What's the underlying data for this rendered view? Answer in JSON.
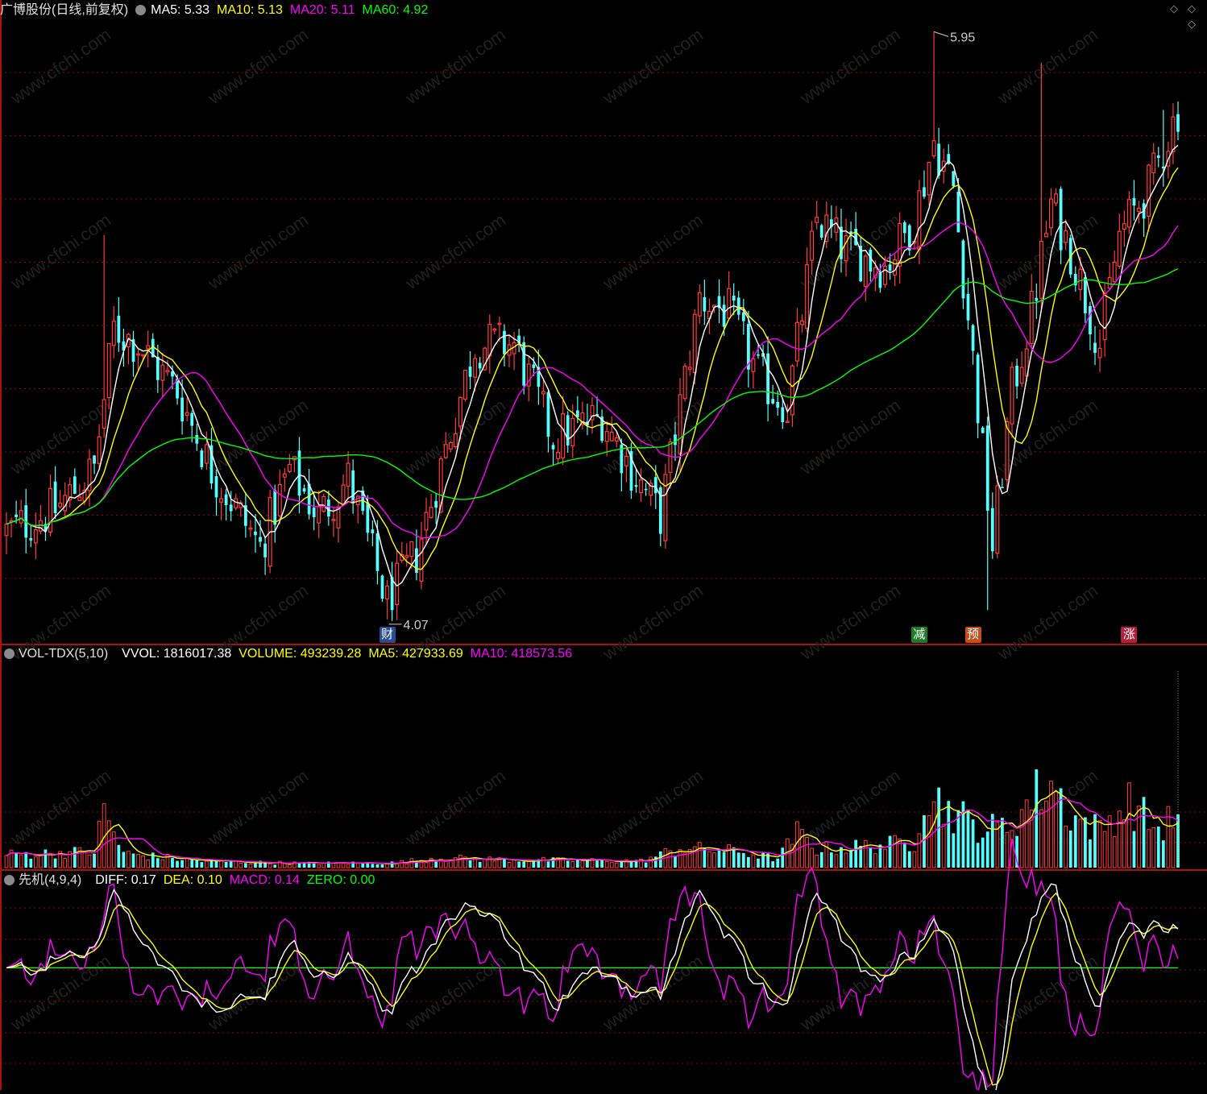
{
  "price_panel": {
    "title": "广博股份(日线,前复权)",
    "ma_items": [
      {
        "label": "MA5: 5.33",
        "color": "#ffffff"
      },
      {
        "label": "MA10: 5.13",
        "color": "#ffff00"
      },
      {
        "label": "MA20: 5.11",
        "color": "#ff00ff"
      },
      {
        "label": "MA60: 4.92",
        "color": "#00ff00"
      }
    ],
    "high_label": "5.95",
    "low_label": "4.07",
    "events": [
      {
        "label": "财",
        "day": 78,
        "bg": "#2a4d8f"
      },
      {
        "label": "减",
        "day": 187,
        "bg": "#1f7a2a"
      },
      {
        "label": "预",
        "day": 198,
        "bg": "#c0501c"
      },
      {
        "label": "涨",
        "day": 230,
        "bg": "#b0203a"
      }
    ]
  },
  "volume_panel": {
    "title": "VOL-TDX(5,10)",
    "items": [
      {
        "label": "VVOL: 1816017.38",
        "color": "#ffffff"
      },
      {
        "label": "VOLUME: 493239.28",
        "color": "#ffff00"
      },
      {
        "label": "MA5: 427933.69",
        "color": "#ffff00"
      },
      {
        "label": "MA10: 418573.56",
        "color": "#ff00ff"
      }
    ]
  },
  "macd_panel": {
    "title": "先机(4,9,4)",
    "items": [
      {
        "label": "DIFF: 0.17",
        "color": "#ffffff"
      },
      {
        "label": "DEA: 0.10",
        "color": "#ffff00"
      },
      {
        "label": "MACD: 0.14",
        "color": "#ff00ff"
      },
      {
        "label": "ZERO: 0.00",
        "color": "#00ff00"
      }
    ]
  },
  "corner_icons": [
    "diamond-icon",
    "diamond-icon",
    "diamond-icon"
  ],
  "watermark": "www.cfchi.com",
  "colors": {
    "up": "#ff3b3b",
    "down": "#54ffff",
    "grid": "#8a0a0a",
    "border": "#aa1111"
  },
  "chart_data": {
    "type": "candlestick",
    "days": 241,
    "price_range": [
      4.0,
      6.0
    ],
    "price_min": 4.07,
    "price_max": 5.95,
    "ma_periods": [
      5,
      10,
      20,
      60
    ],
    "price_path": [
      [
        0,
        4.35
      ],
      [
        10,
        4.42
      ],
      [
        18,
        4.55
      ],
      [
        22,
        5.0
      ],
      [
        27,
        4.95
      ],
      [
        35,
        4.8
      ],
      [
        42,
        4.55
      ],
      [
        46,
        4.45
      ],
      [
        52,
        4.3
      ],
      [
        58,
        4.55
      ],
      [
        64,
        4.4
      ],
      [
        70,
        4.52
      ],
      [
        78,
        4.12
      ],
      [
        84,
        4.28
      ],
      [
        96,
        4.95
      ],
      [
        104,
        4.95
      ],
      [
        112,
        4.65
      ],
      [
        122,
        4.72
      ],
      [
        128,
        4.55
      ],
      [
        134,
        4.4
      ],
      [
        142,
        5.1
      ],
      [
        148,
        5.05
      ],
      [
        154,
        4.85
      ],
      [
        160,
        4.75
      ],
      [
        166,
        5.35
      ],
      [
        172,
        5.25
      ],
      [
        180,
        5.2
      ],
      [
        186,
        5.35
      ],
      [
        190,
        5.6
      ],
      [
        194,
        5.45
      ],
      [
        198,
        4.9
      ],
      [
        202,
        4.3
      ],
      [
        206,
        4.8
      ],
      [
        210,
        5.05
      ],
      [
        214,
        5.4
      ],
      [
        218,
        5.25
      ],
      [
        224,
        4.95
      ],
      [
        228,
        5.3
      ],
      [
        234,
        5.45
      ],
      [
        240,
        5.7
      ]
    ],
    "spikes": [
      {
        "day": 190,
        "high": 5.95
      },
      {
        "day": 20,
        "high": 5.3
      },
      {
        "day": 212,
        "high": 5.85
      },
      {
        "day": 237,
        "high": 5.7
      }
    ],
    "dips": [
      {
        "day": 78,
        "low": 4.07
      },
      {
        "day": 201,
        "low": 4.1
      }
    ],
    "volume_range": [
      0,
      1900000
    ],
    "volume_path": [
      [
        0,
        120000
      ],
      [
        18,
        150000
      ],
      [
        20,
        520000
      ],
      [
        24,
        130000
      ],
      [
        40,
        60000
      ],
      [
        60,
        40000
      ],
      [
        80,
        45000
      ],
      [
        88,
        90000
      ],
      [
        100,
        75000
      ],
      [
        130,
        60000
      ],
      [
        138,
        180000
      ],
      [
        150,
        150000
      ],
      [
        158,
        80000
      ],
      [
        162,
        320000
      ],
      [
        166,
        170000
      ],
      [
        186,
        230000
      ],
      [
        188,
        730000
      ],
      [
        192,
        570000
      ],
      [
        200,
        350000
      ],
      [
        206,
        400000
      ],
      [
        210,
        640000
      ],
      [
        214,
        800000
      ],
      [
        218,
        480000
      ],
      [
        224,
        350000
      ],
      [
        230,
        600000
      ],
      [
        236,
        350000
      ],
      [
        240,
        493239
      ]
    ],
    "macd_range": [
      -0.5,
      0.33
    ],
    "final": {
      "ma5": 5.33,
      "ma10": 5.13,
      "ma20": 5.11,
      "ma60": 4.92,
      "diff": 0.17,
      "dea": 0.1,
      "macd": 0.14,
      "volume": 493239.28,
      "vol_ma5": 427933.69,
      "vol_ma10": 418573.56,
      "vvol": 1816017.38
    }
  }
}
